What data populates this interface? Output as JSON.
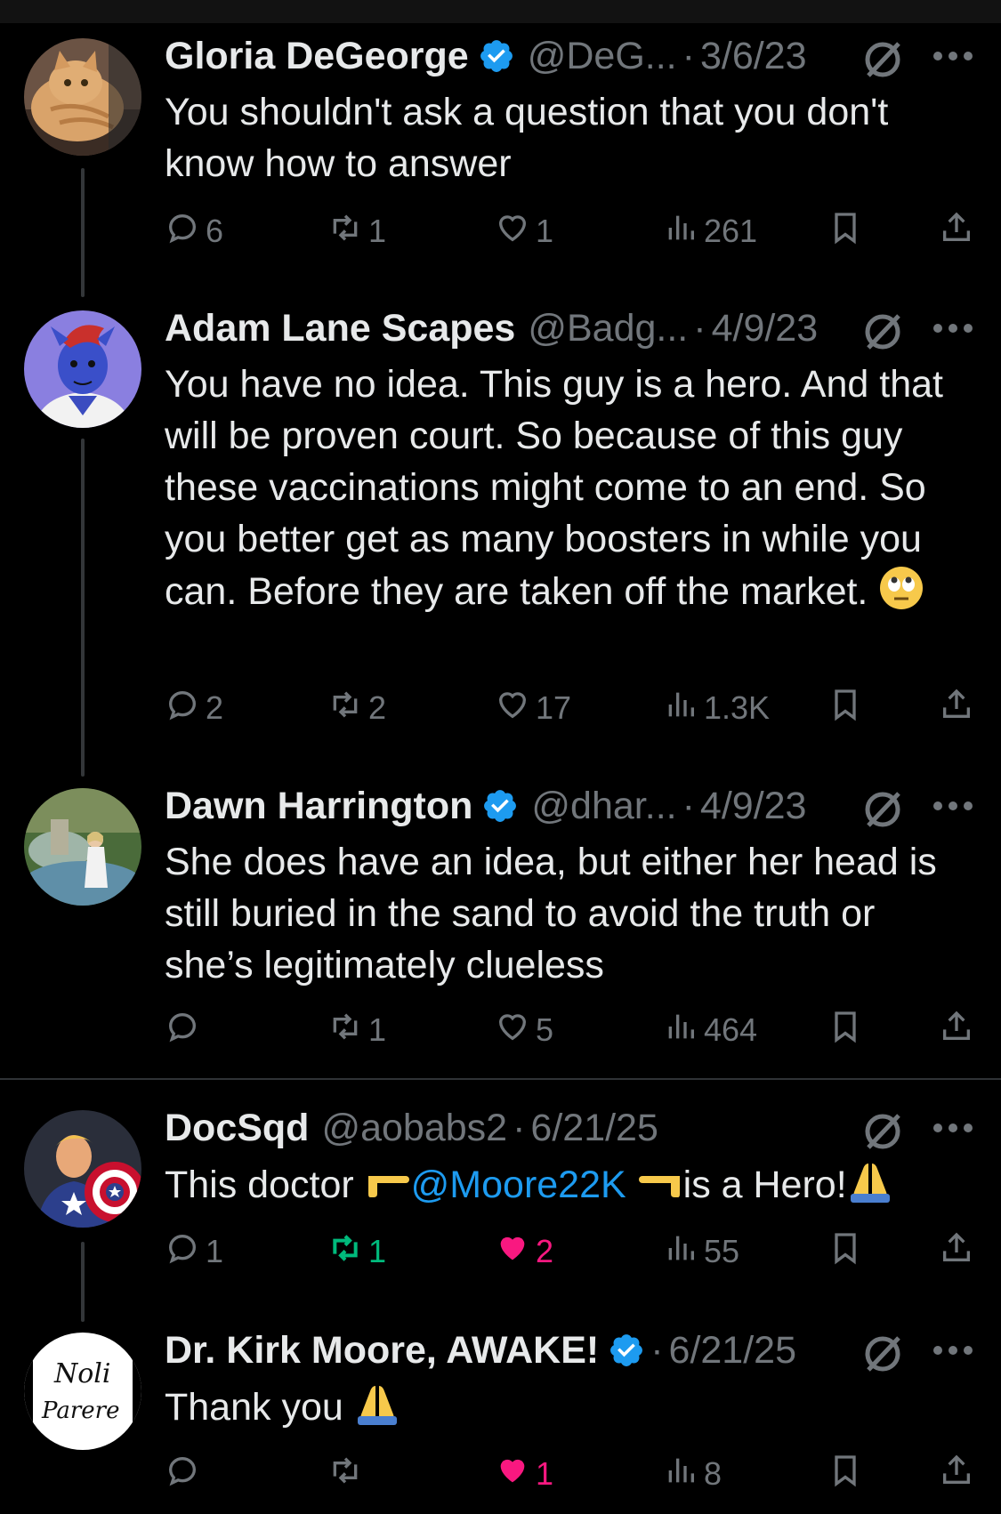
{
  "tweets": [
    {
      "name": "Gloria DeGeorge",
      "verified": true,
      "handle": "@DeG...",
      "date": "3/6/23",
      "text": "You shouldn't ask a question that you don't know how to answer",
      "replies": "6",
      "reposts": "1",
      "likes": "1",
      "views": "261"
    },
    {
      "name": "Adam Lane Scapes",
      "verified": false,
      "handle": "@Badg...",
      "date": "4/9/23",
      "text": "You have no idea. This guy is a hero. And that will be proven court. So because of this guy these vaccinations might come to an end. So you better get as many boosters in while you can. Before they are taken off the market.",
      "emoji": "face-with-rolling-eyes",
      "replies": "2",
      "reposts": "2",
      "likes": "17",
      "views": "1.3K"
    },
    {
      "name": "Dawn Harrington",
      "verified": true,
      "handle": "@dhar...",
      "date": "4/9/23",
      "text": "She does have an idea, but either her head is still buried in the sand to avoid the truth or she’s legitimately clueless",
      "replies": "",
      "reposts": "1",
      "likes": "5",
      "views": "464"
    },
    {
      "name": "DocSqd",
      "verified": false,
      "handle": "@aobabs2",
      "date": "6/21/25",
      "text_before": "This doctor ",
      "mention": "@Moore22K",
      "text_after": "is a Hero!",
      "replies": "1",
      "reposts": "1",
      "likes": "2",
      "views": "55",
      "reposted": true,
      "liked": true
    },
    {
      "name": "Dr. Kirk Moore, AWAKE!",
      "verified": true,
      "handle": "",
      "date": "6/21/25",
      "text": "Thank you",
      "replies": "",
      "reposts": "",
      "likes": "1",
      "views": "8",
      "liked": true
    }
  ],
  "avatar_text": [
    "Noli",
    "Parere"
  ],
  "separator": "·",
  "colors": {
    "background": "#000000",
    "text": "#e7e9ea",
    "muted": "#71767b",
    "verified": "#1d9bf0",
    "mention": "#1d9bf0",
    "repost_active": "#00ba7c",
    "like_active": "#f91880"
  },
  "icons": [
    "reply-icon",
    "repost-icon",
    "like-icon",
    "views-icon",
    "bookmark-icon",
    "share-icon",
    "grok-icon",
    "more-icon",
    "verified-badge-icon"
  ]
}
